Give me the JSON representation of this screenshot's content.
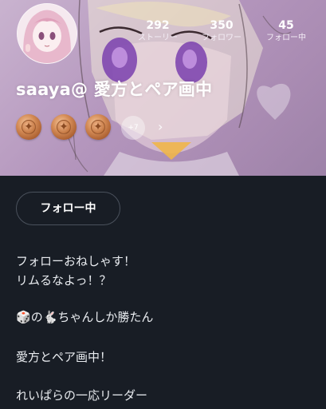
{
  "profile": {
    "username": "saaya@ 愛方とペア画中",
    "stats": [
      {
        "value": "292",
        "label": "ストーリー"
      },
      {
        "value": "350",
        "label": "フォロワー"
      },
      {
        "value": "45",
        "label": "フォロー中"
      }
    ],
    "badges": {
      "count_shown": 3,
      "more_label": "+7"
    },
    "follow_button_label": "フォロー中"
  },
  "bio": {
    "line1": "フォローおねしゃす！",
    "line2": "リムるなよっ！？",
    "line3_dice": "🎲",
    "line3_no": "の",
    "line3_rabbit": "🐇",
    "line3_rest": "ちゃんしか勝たん",
    "line4": "愛方とペア画中！",
    "line5": "れいぱらの一応リーダー"
  },
  "colors": {
    "background": "#181d25",
    "header_purple": "#b496bd",
    "badge_bronze": "#c67a45"
  }
}
